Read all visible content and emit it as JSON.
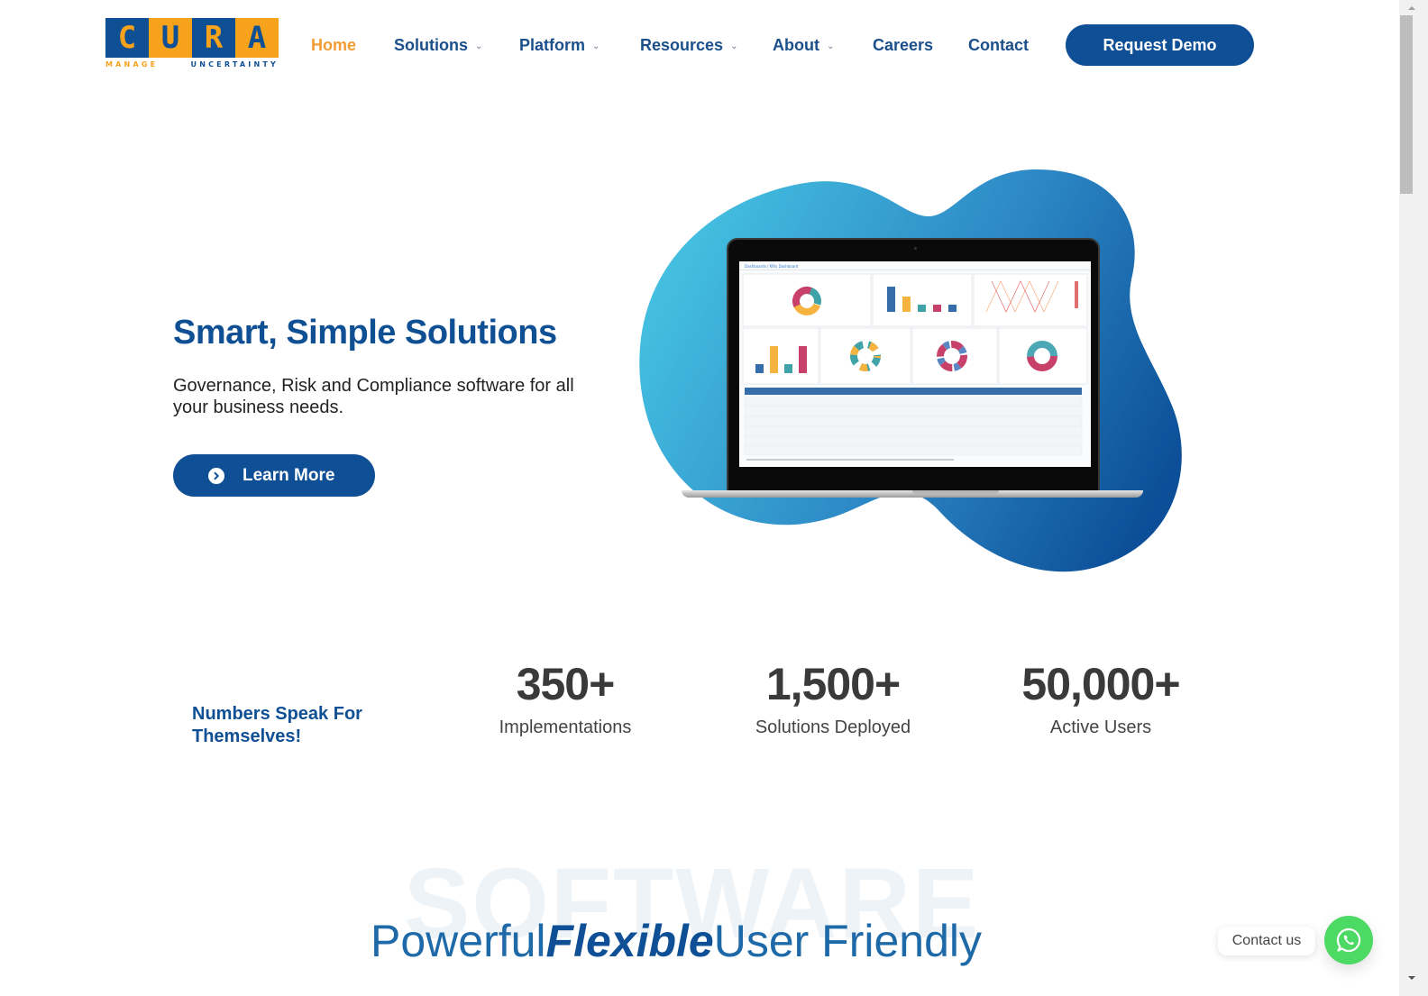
{
  "brand": {
    "letters": [
      "C",
      "U",
      "R",
      "A"
    ],
    "tagline_part1": "MANAGE",
    "tagline_part2": "UNCERTAINTY",
    "colors": {
      "primary": "#0e4f95",
      "accent": "#f7a21b",
      "whatsapp": "#4cd964"
    }
  },
  "nav": {
    "items": [
      {
        "label": "Home",
        "active": true,
        "dropdown": false
      },
      {
        "label": "Solutions",
        "active": false,
        "dropdown": true
      },
      {
        "label": "Platform",
        "active": false,
        "dropdown": true
      },
      {
        "label": "Resources",
        "active": false,
        "dropdown": true
      },
      {
        "label": "About",
        "active": false,
        "dropdown": true
      },
      {
        "label": "Careers",
        "active": false,
        "dropdown": false
      },
      {
        "label": "Contact",
        "active": false,
        "dropdown": false
      }
    ],
    "chevron_icon": "chevron-down-icon",
    "cta_label": "Request Demo"
  },
  "hero": {
    "title": "Smart, Simple Solutions",
    "subtitle": "Governance, Risk and Compliance software for all your business needs.",
    "button_label": "Learn More",
    "button_icon": "chevron-right-circle-icon",
    "screen_breadcrumb": "Dashboards / KRIs Dashboard"
  },
  "stats": {
    "heading": "Numbers Speak For Themselves!",
    "items": [
      {
        "value": "350+",
        "label": "Implementations"
      },
      {
        "value": "1,500+",
        "label": "Solutions Deployed"
      },
      {
        "value": "50,000+",
        "label": "Active Users"
      }
    ]
  },
  "software": {
    "watermark": "SOFTWARE",
    "word1": "Powerful",
    "word2": "Flexible",
    "word3": "User Friendly"
  },
  "contact_widget": {
    "label": "Contact us",
    "icon": "whatsapp-icon"
  }
}
